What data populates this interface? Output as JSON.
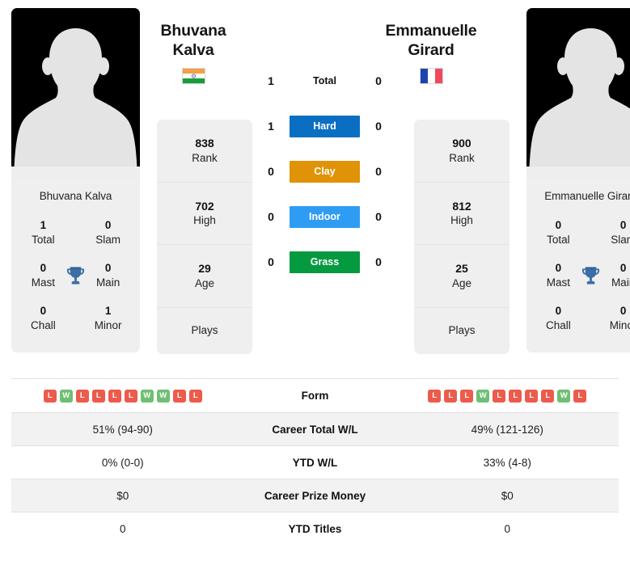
{
  "players": {
    "left": {
      "first_name": "Bhuvana",
      "last_name": "Kalva",
      "full_name": "Bhuvana Kalva",
      "flag_country": "India",
      "flag_icon": "flag-india-icon",
      "avatar_icon": "player-avatar-placeholder-icon",
      "rank": "838",
      "rank_label": "Rank",
      "high": "702",
      "high_label": "High",
      "age": "29",
      "age_label": "Age",
      "plays": "",
      "plays_label": "Plays",
      "titles": {
        "total": "1",
        "total_label": "Total",
        "slam": "0",
        "slam_label": "Slam",
        "mast": "0",
        "mast_label": "Mast",
        "main": "0",
        "main_label": "Main",
        "chall": "0",
        "chall_label": "Chall",
        "minor": "1",
        "minor_label": "Minor"
      },
      "form": [
        "L",
        "W",
        "L",
        "L",
        "L",
        "L",
        "W",
        "W",
        "L",
        "L"
      ],
      "career_total_wl": "51% (94-90)",
      "ytd_wl": "0% (0-0)",
      "career_prize_money": "$0",
      "ytd_titles": "0"
    },
    "right": {
      "first_name": "Emmanuelle",
      "last_name": "Girard",
      "full_name": "Emmanuelle Girard",
      "flag_country": "France",
      "flag_icon": "flag-france-icon",
      "avatar_icon": "player-avatar-placeholder-icon",
      "rank": "900",
      "rank_label": "Rank",
      "high": "812",
      "high_label": "High",
      "age": "25",
      "age_label": "Age",
      "plays": "",
      "plays_label": "Plays",
      "titles": {
        "total": "0",
        "total_label": "Total",
        "slam": "0",
        "slam_label": "Slam",
        "mast": "0",
        "mast_label": "Mast",
        "main": "0",
        "main_label": "Main",
        "chall": "0",
        "chall_label": "Chall",
        "minor": "0",
        "minor_label": "Minor"
      },
      "form": [
        "L",
        "L",
        "L",
        "W",
        "L",
        "L",
        "L",
        "L",
        "W",
        "L"
      ],
      "career_total_wl": "49% (121-126)",
      "ytd_wl": "33% (4-8)",
      "career_prize_money": "$0",
      "ytd_titles": "0"
    }
  },
  "head_to_head": {
    "rows": [
      {
        "label": "Total",
        "left": "1",
        "right": "0",
        "badge": false,
        "color": ""
      },
      {
        "label": "Hard",
        "left": "1",
        "right": "0",
        "badge": true,
        "color": "#0a6fc2"
      },
      {
        "label": "Clay",
        "left": "0",
        "right": "0",
        "badge": true,
        "color": "#e09306"
      },
      {
        "label": "Indoor",
        "left": "0",
        "right": "0",
        "badge": true,
        "color": "#2f9cf4"
      },
      {
        "label": "Grass",
        "left": "0",
        "right": "0",
        "badge": true,
        "color": "#069a40"
      }
    ]
  },
  "comparison_table": {
    "rows": [
      {
        "name": "Form",
        "left": "",
        "right": "",
        "type": "form"
      },
      {
        "name": "Career Total W/L",
        "left": "51% (94-90)",
        "right": "49% (121-126)",
        "type": "text"
      },
      {
        "name": "YTD W/L",
        "left": "0% (0-0)",
        "right": "33% (4-8)",
        "type": "text"
      },
      {
        "name": "Career Prize Money",
        "left": "$0",
        "right": "$0",
        "type": "text"
      },
      {
        "name": "YTD Titles",
        "left": "0",
        "right": "0",
        "type": "text"
      }
    ]
  },
  "colors": {
    "win_badge": "#ec5b4c",
    "loss_badge": "#ec5b4c",
    "win": "#6fbf73",
    "loss": "#ec5b4c",
    "trophy": "#3a6ea5",
    "card_bg": "#efefef",
    "row_alt_bg": "#f2f2f2"
  },
  "trophy_icon": "trophy-icon"
}
